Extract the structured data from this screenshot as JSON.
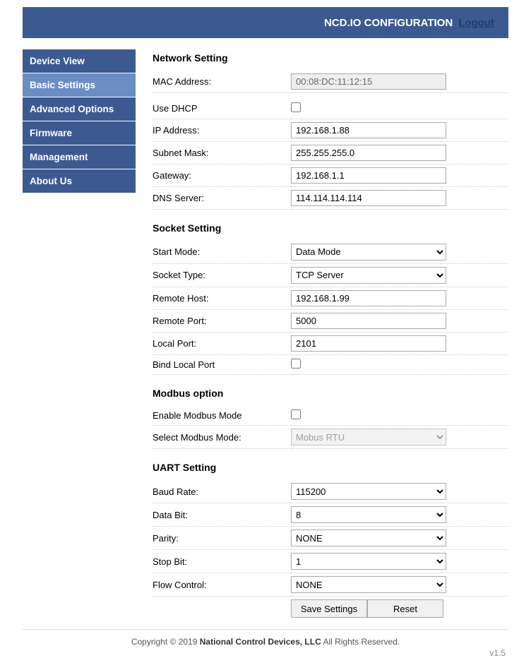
{
  "header": {
    "title": "NCD.IO CONFIGURATION",
    "logout": "Logout"
  },
  "sidebar": {
    "items": [
      "Device View",
      "Basic Settings",
      "Advanced Options",
      "Firmware",
      "Management",
      "About Us"
    ],
    "active_index": 1
  },
  "sections": {
    "network": {
      "title": "Network Setting",
      "mac_label": "MAC Address:",
      "mac_value": "00:08:DC:11:12:15",
      "dhcp_label": "Use DHCP",
      "dhcp_checked": false,
      "ip_label": "IP Address:",
      "ip_value": "192.168.1.88",
      "subnet_label": "Subnet Mask:",
      "subnet_value": "255.255.255.0",
      "gateway_label": "Gateway:",
      "gateway_value": "192.168.1.1",
      "dns_label": "DNS Server:",
      "dns_value": "114.114.114.114"
    },
    "socket": {
      "title": "Socket Setting",
      "start_mode_label": "Start Mode:",
      "start_mode_value": "Data Mode",
      "socket_type_label": "Socket Type:",
      "socket_type_value": "TCP Server",
      "remote_host_label": "Remote Host:",
      "remote_host_value": "192.168.1.99",
      "remote_port_label": "Remote Port:",
      "remote_port_value": "5000",
      "local_port_label": "Local Port:",
      "local_port_value": "2101",
      "bind_label": "Bind Local Port",
      "bind_checked": false
    },
    "modbus": {
      "title": "Modbus option",
      "enable_label": "Enable Modbus Mode",
      "enable_checked": false,
      "select_label": "Select Modbus Mode:",
      "select_value": "Mobus RTU",
      "select_disabled": true
    },
    "uart": {
      "title": "UART Setting",
      "baud_label": "Baud Rate:",
      "baud_value": "115200",
      "databit_label": "Data Bit:",
      "databit_value": "8",
      "parity_label": "Parity:",
      "parity_value": "NONE",
      "stopbit_label": "Stop Bit:",
      "stopbit_value": "1",
      "flow_label": "Flow Control:",
      "flow_value": "NONE"
    }
  },
  "buttons": {
    "save": "Save Settings",
    "reset": "Reset"
  },
  "footer": {
    "copyright_pre": "Copyright © 2019 ",
    "company": "National Control Devices, LLC",
    "copyright_post": " All Rights Reserved.",
    "version": "v1.5"
  }
}
